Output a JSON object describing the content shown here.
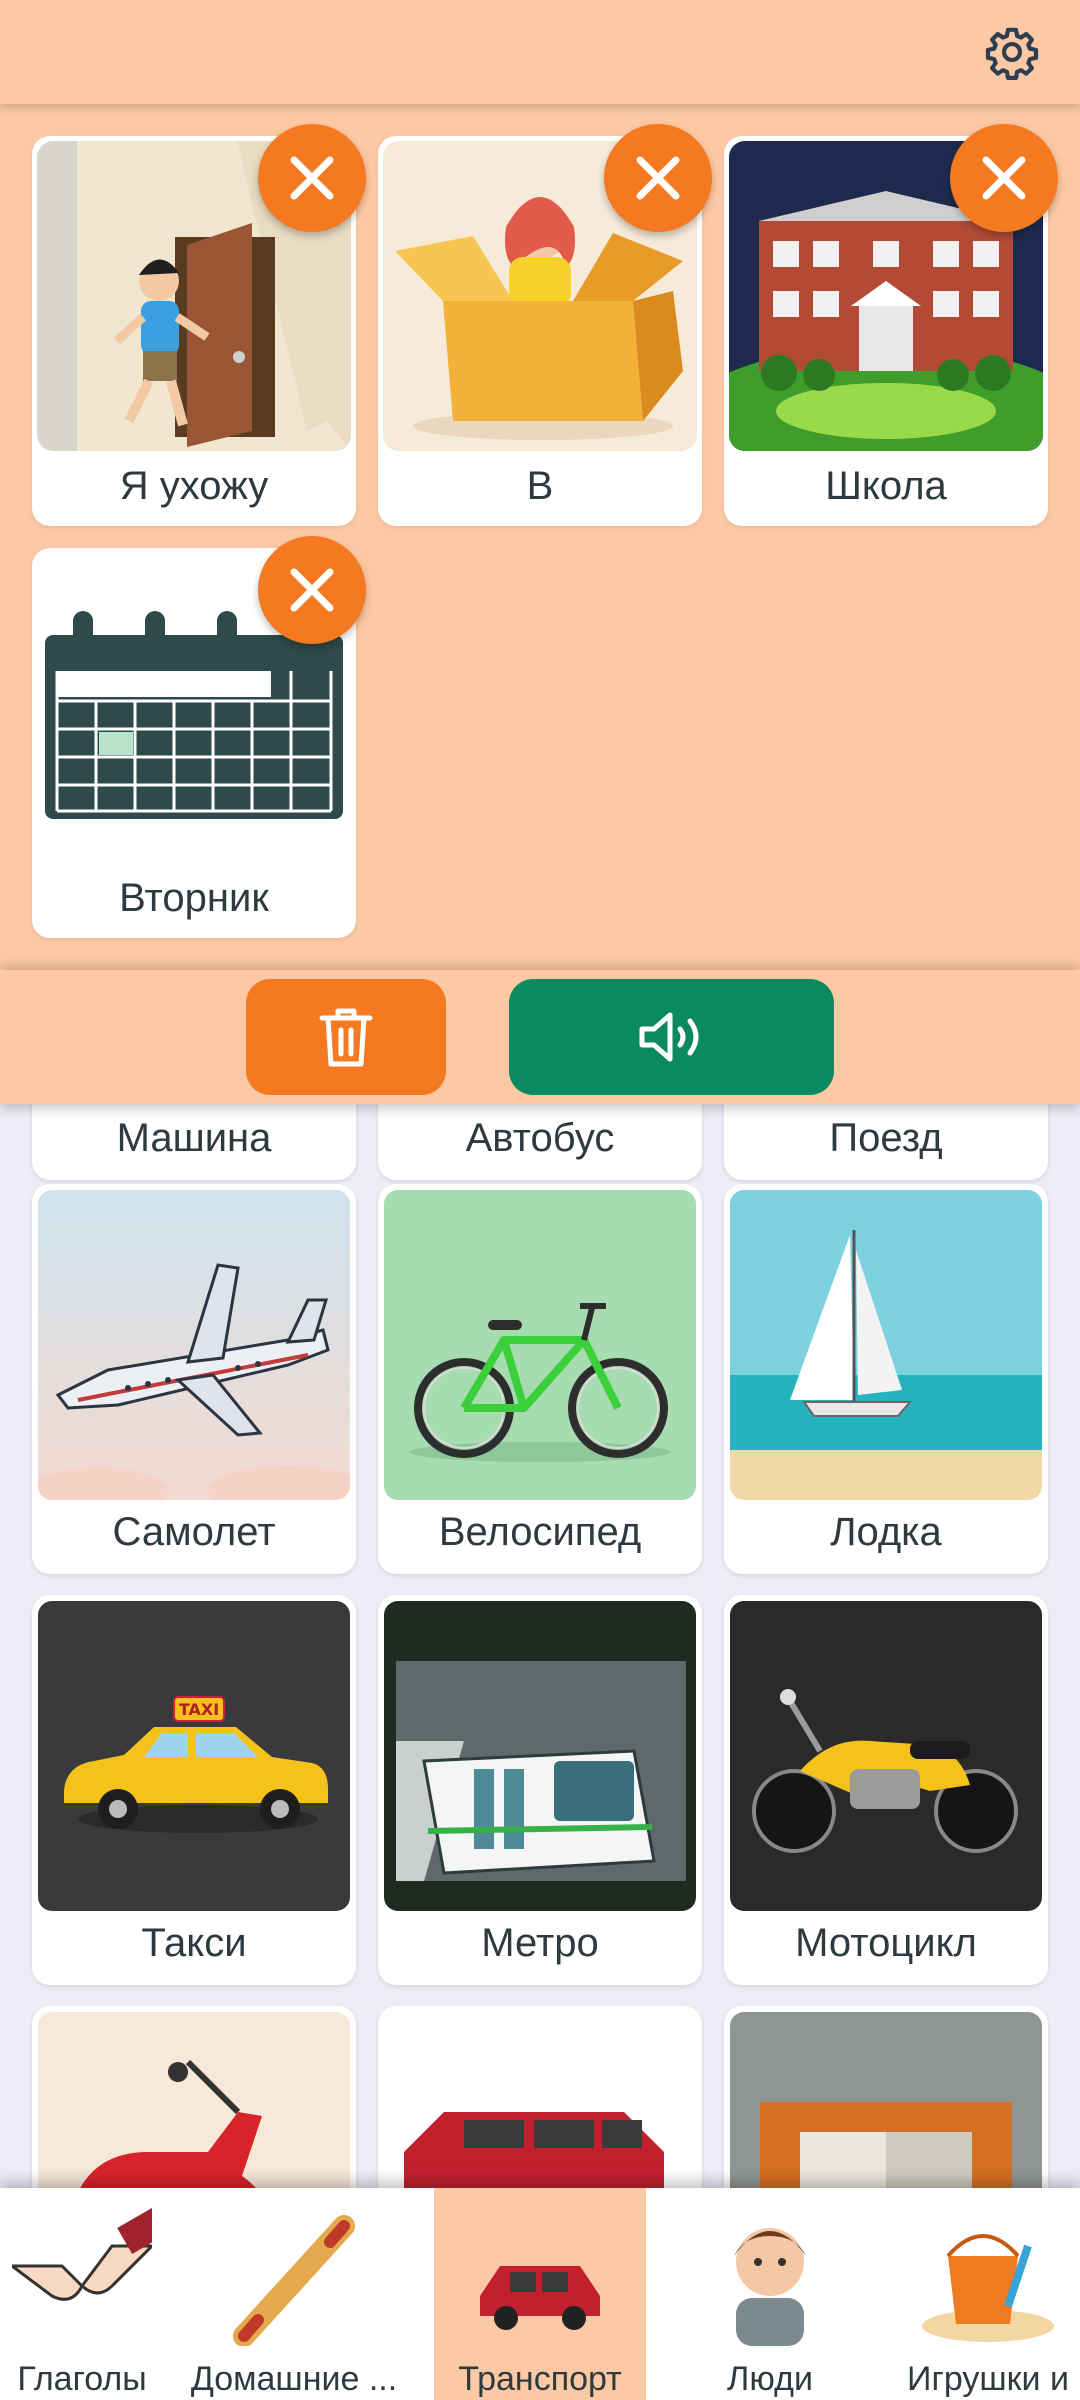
{
  "header": {
    "settings_icon": "gear-icon"
  },
  "sentence": {
    "cards": [
      {
        "label": "Я ухожу",
        "icon": "boy-leaving-door"
      },
      {
        "label": "В",
        "icon": "girl-in-box"
      },
      {
        "label": "Школа",
        "icon": "school-building"
      },
      {
        "label": "Вторник",
        "icon": "calendar"
      }
    ]
  },
  "actions": {
    "delete_icon": "trash-icon",
    "speak_icon": "speaker-icon"
  },
  "grid": {
    "row0": [
      {
        "label": "Машина"
      },
      {
        "label": "Автобус"
      },
      {
        "label": "Поезд"
      }
    ],
    "row1": [
      {
        "label": "Самолет",
        "icon": "airplane"
      },
      {
        "label": "Велосипед",
        "icon": "bicycle"
      },
      {
        "label": "Лодка",
        "icon": "sailboat"
      }
    ],
    "row2": [
      {
        "label": "Такси",
        "icon": "taxi"
      },
      {
        "label": "Метро",
        "icon": "metro-train"
      },
      {
        "label": "Мотоцикл",
        "icon": "motorcycle"
      }
    ],
    "row3": [
      {
        "icon": "scooter"
      },
      {
        "icon": "red-van"
      },
      {
        "icon": "elevator-door"
      }
    ]
  },
  "categories": [
    {
      "label": "Глаголы",
      "icon": "holding-hands"
    },
    {
      "label": "Домашние ...",
      "icon": "rolling-pin"
    },
    {
      "label": "Транспорт",
      "icon": "red-van",
      "active": true
    },
    {
      "label": "Люди",
      "icon": "boy"
    },
    {
      "label": "Игрушки и",
      "icon": "sand-bucket"
    }
  ],
  "colors": {
    "accent_peach": "#fdc9a4",
    "orange": "#f57920",
    "green": "#0b8a62",
    "page_bg": "#eeedf6"
  }
}
